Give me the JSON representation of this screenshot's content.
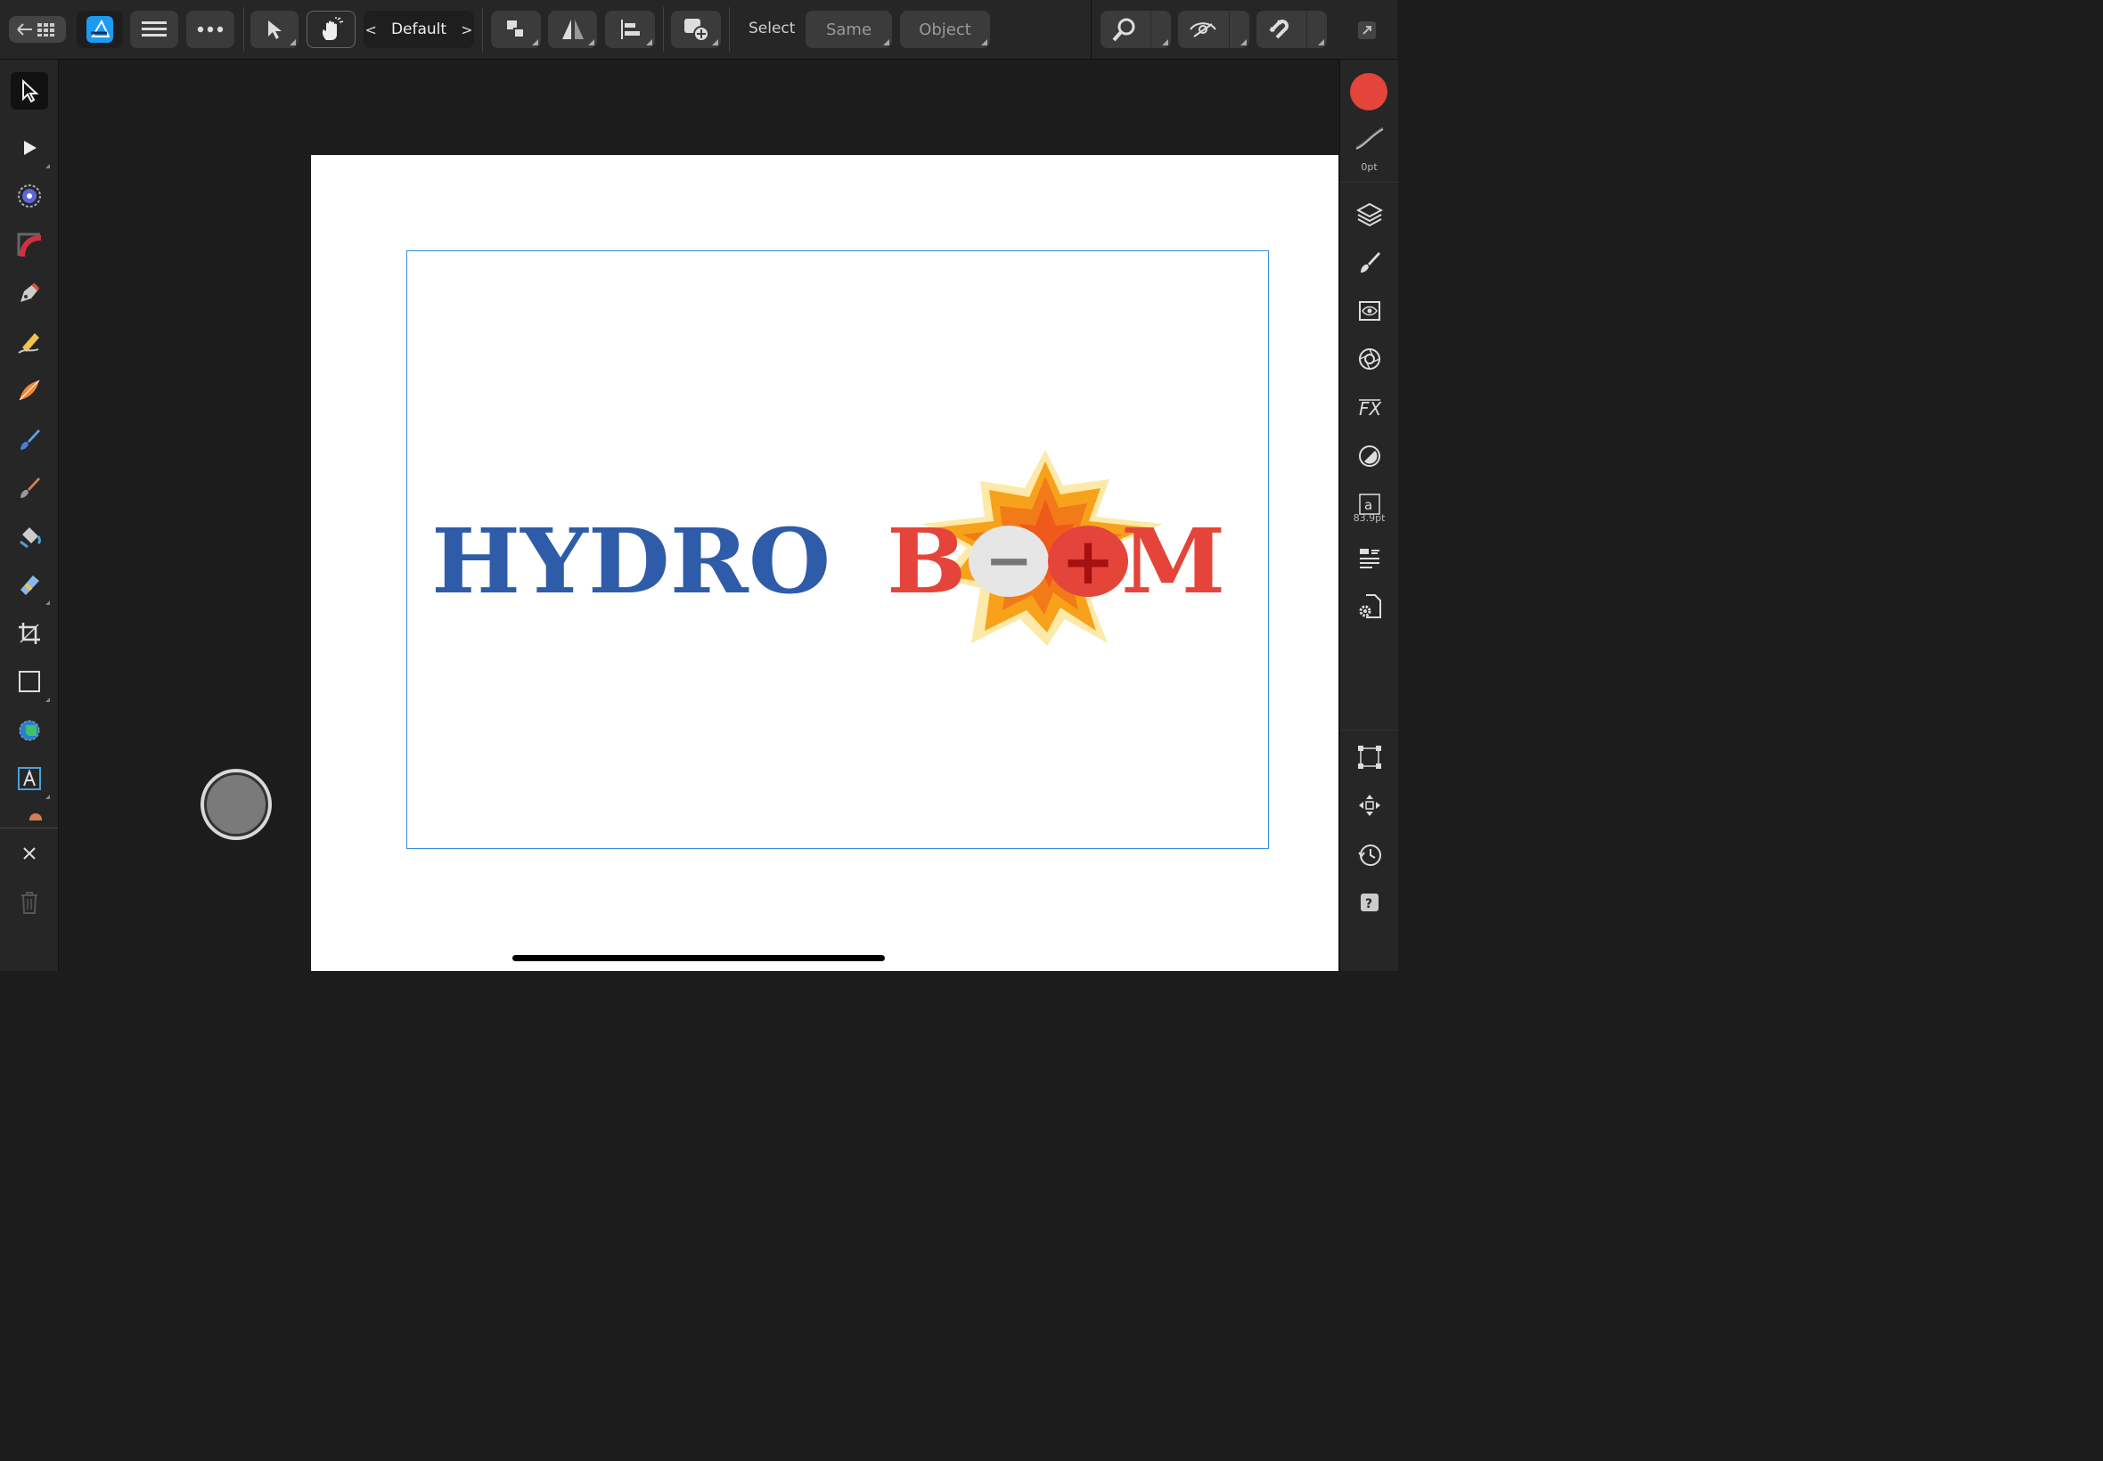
{
  "toolbar": {
    "persona_label": "Default",
    "select_label": "Select",
    "same_label": "Same",
    "object_label": "Object"
  },
  "logo": {
    "part1": "HYDRO",
    "part2_b": "B",
    "part2_m": "M",
    "minus_sign": "−",
    "plus_sign": "+"
  },
  "right_panel": {
    "stroke_width": "0pt",
    "font_size": "83.9pt"
  },
  "colors": {
    "fill_color": "#e5443a",
    "logo_blue": "#2f5ca8",
    "logo_red": "#e5443a",
    "selection_border": "#3a8fe0"
  },
  "icons": {
    "left": [
      "move-tool-icon",
      "node-tool-icon",
      "contour-tool-icon",
      "corner-tool-icon",
      "pen-tool-icon",
      "pencil-tool-icon",
      "vector-brush-icon",
      "paint-brush-icon",
      "pixel-brush-icon",
      "fill-tool-icon",
      "transparency-tool-icon",
      "crop-tool-icon",
      "rectangle-tool-icon",
      "shape-builder-icon",
      "artistic-text-icon"
    ],
    "right": [
      "layers-icon",
      "brushes-icon",
      "stock-icon",
      "appearance-icon",
      "effects-icon",
      "color-adjust-icon",
      "text-styles-icon",
      "paragraph-icon",
      "document-settings-icon",
      "transform-icon",
      "move-icon",
      "history-icon",
      "help-icon"
    ]
  }
}
